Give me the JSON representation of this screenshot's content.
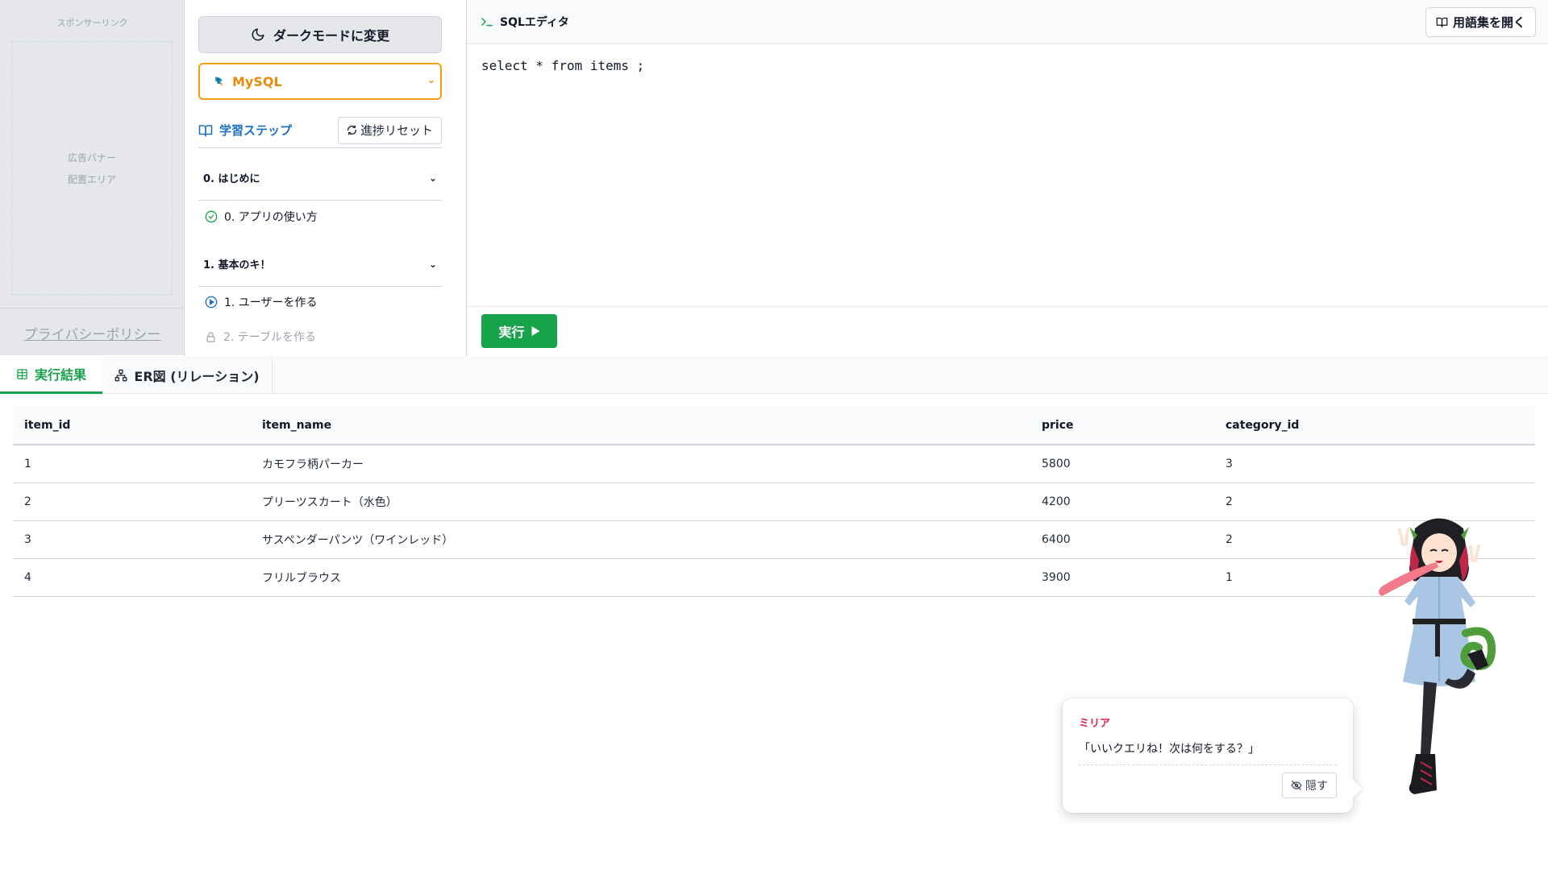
{
  "ad": {
    "sponsor_label": "スポンサーリンク",
    "banner_line1": "広告バナー",
    "banner_line2": "配置エリア",
    "privacy_link": "プライバシーポリシー"
  },
  "sidebar": {
    "darkmode_label": "ダークモードに変更",
    "db_selected": "MySQL",
    "steps_title": "学習ステップ",
    "reset_label": "進捗リセット",
    "sections": [
      {
        "title": "0. はじめに",
        "lessons": [
          {
            "label": "0. アプリの使い方",
            "status": "completed"
          }
        ]
      },
      {
        "title": "1. 基本のキ！",
        "lessons": [
          {
            "label": "1. ユーザーを作る",
            "status": "current"
          },
          {
            "label": "2. テーブルを作る",
            "status": "locked"
          }
        ]
      }
    ]
  },
  "editor": {
    "title": "SQLエディタ",
    "glossary_label": "用語集を開く",
    "code": "select * from items ;",
    "run_label": "実行"
  },
  "tabs": {
    "results_label": "実行結果",
    "er_label": "ER図 (リレーション)"
  },
  "results": {
    "columns": [
      "item_id",
      "item_name",
      "price",
      "category_id"
    ],
    "rows": [
      [
        "1",
        "カモフラ柄パーカー",
        "5800",
        "3"
      ],
      [
        "2",
        "プリーツスカート（水色）",
        "4200",
        "2"
      ],
      [
        "3",
        "サスペンダーパンツ（ワインレッド）",
        "6400",
        "2"
      ],
      [
        "4",
        "フリルブラウス",
        "3900",
        "1"
      ]
    ]
  },
  "bubble": {
    "name": "ミリア",
    "message": "「いいクエリね！次は何をする？」",
    "hide_label": "隠す"
  },
  "colors": {
    "accent_green": "#16a34a",
    "accent_blue": "#1d6fc4",
    "mysql_orange": "#ea8a0c",
    "name_pink": "#e11d48"
  }
}
